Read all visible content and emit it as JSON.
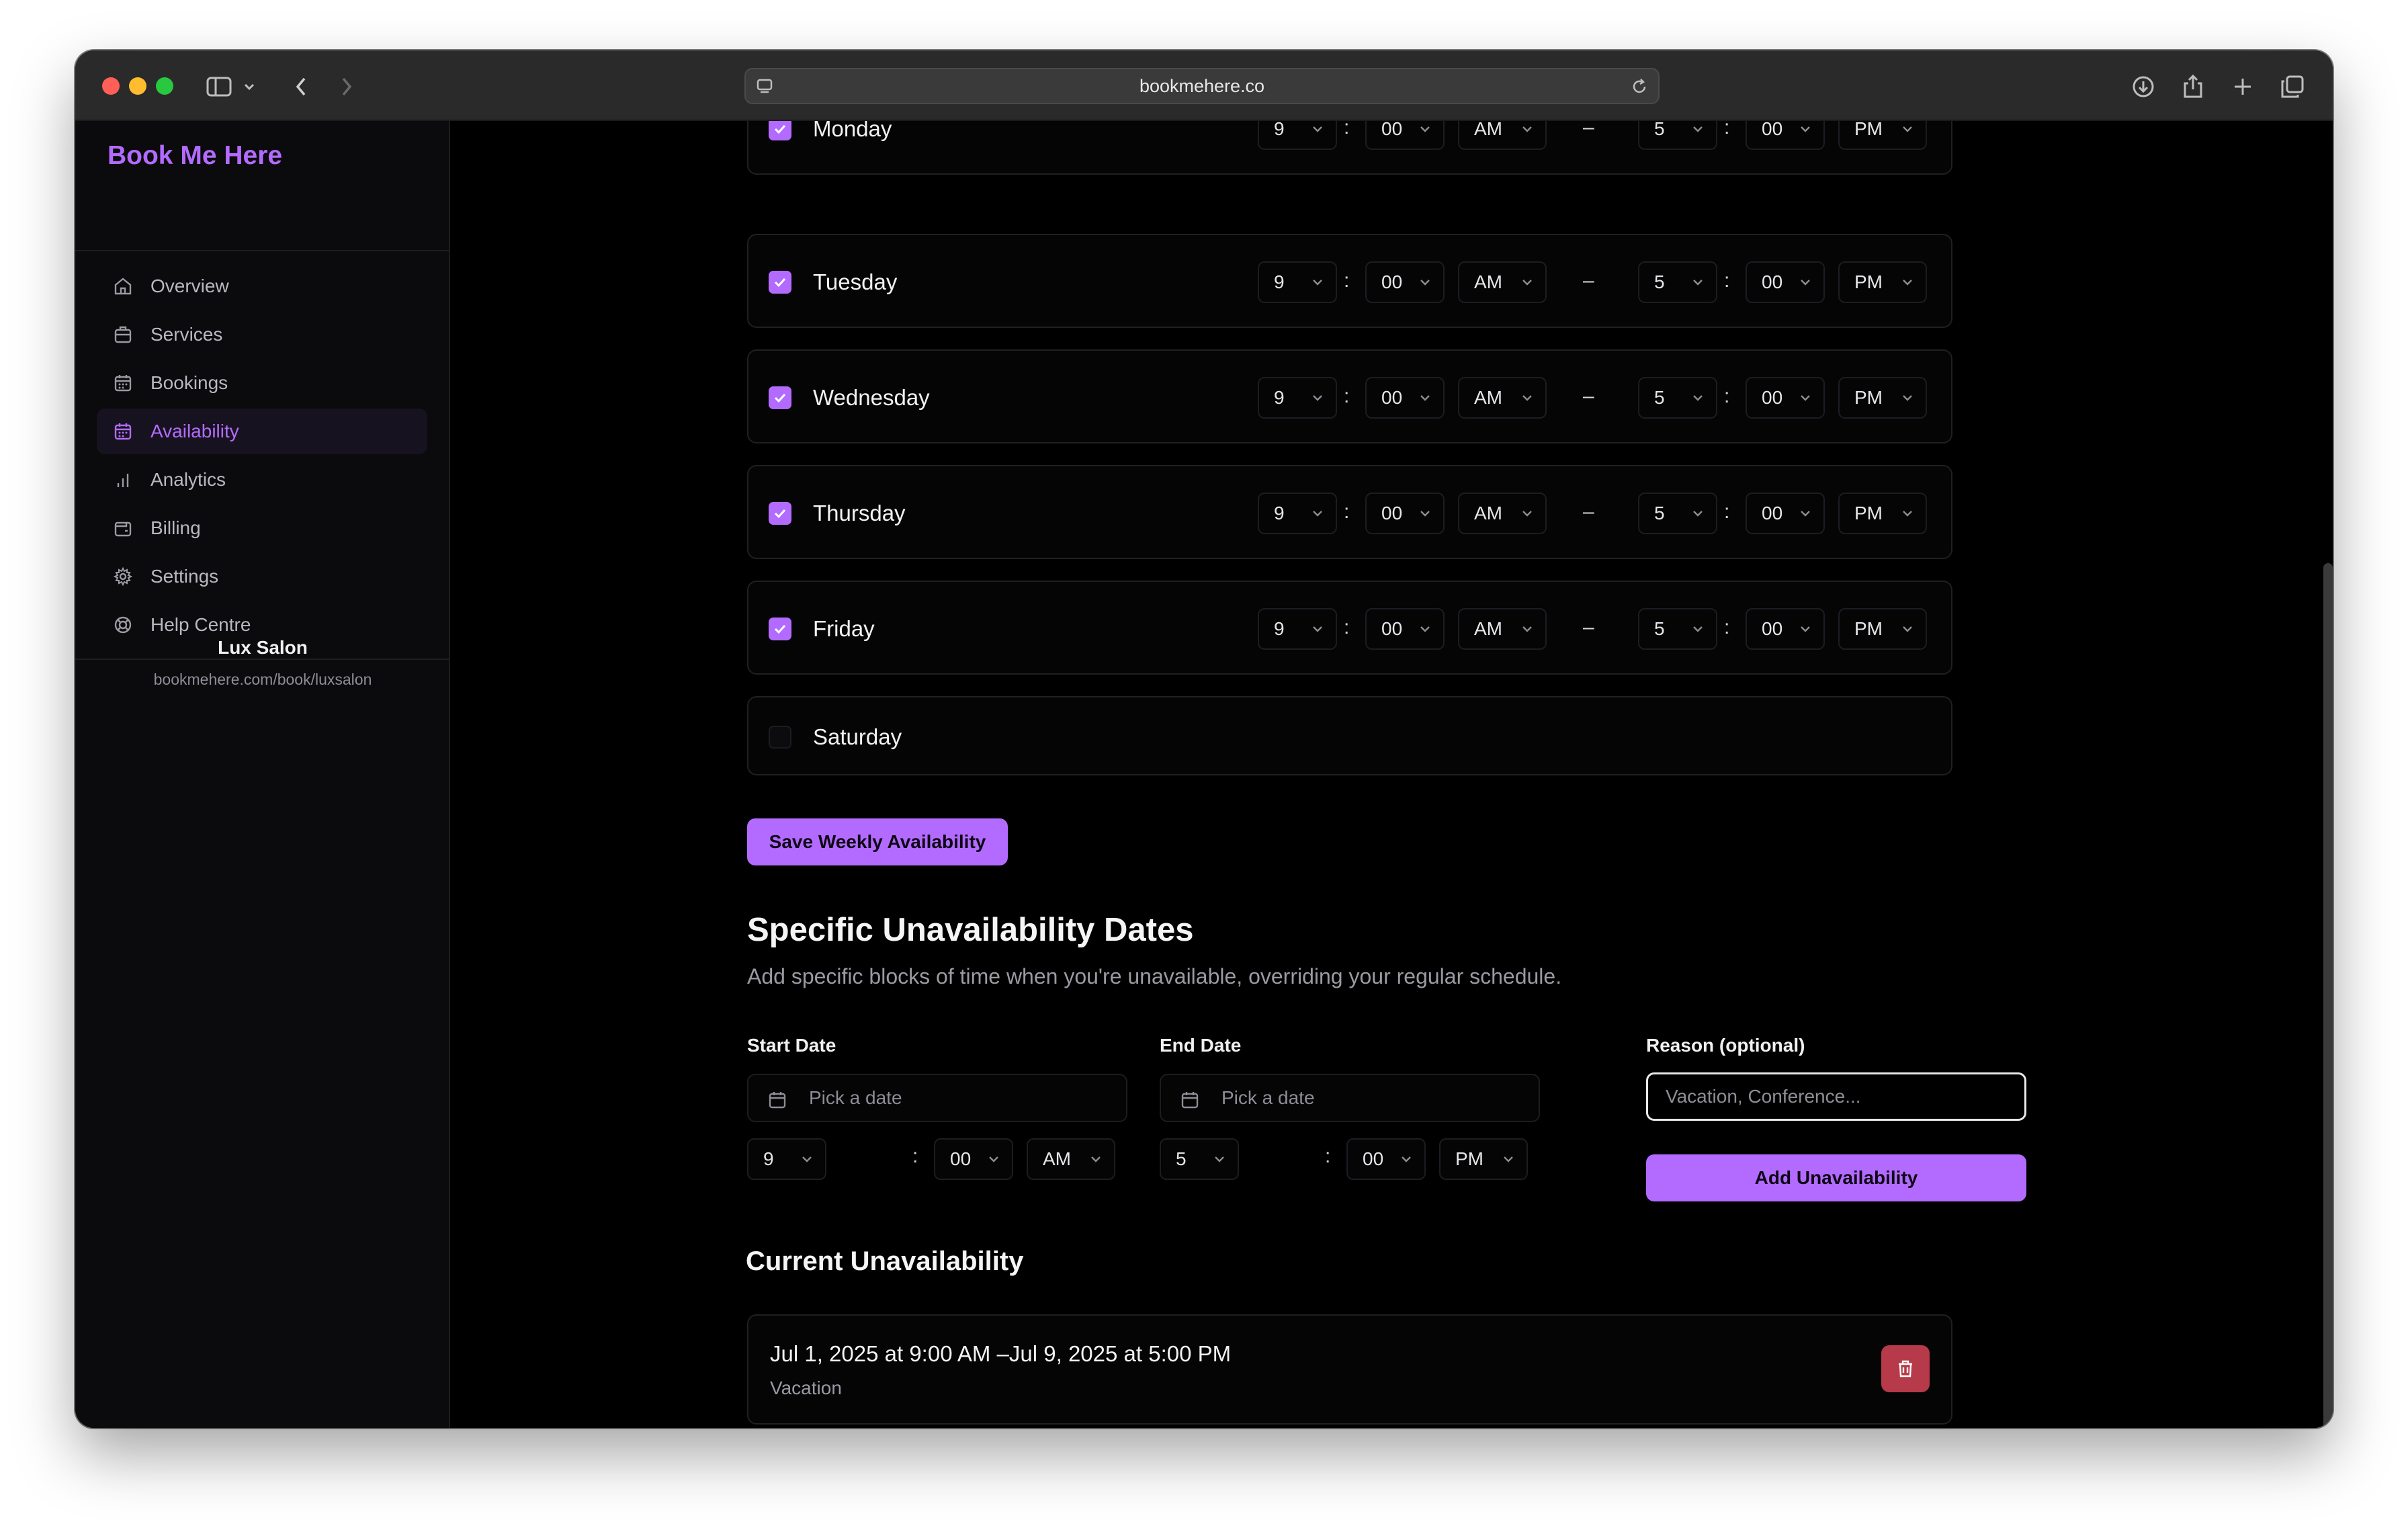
{
  "browser": {
    "url": "bookmehere.co"
  },
  "sidebar": {
    "brand": "Book Me Here",
    "items": [
      {
        "label": "Overview"
      },
      {
        "label": "Services"
      },
      {
        "label": "Bookings"
      },
      {
        "label": "Availability",
        "active": true
      },
      {
        "label": "Analytics"
      },
      {
        "label": "Billing"
      },
      {
        "label": "Settings"
      },
      {
        "label": "Help Centre"
      }
    ],
    "salon_name": "Lux Salon",
    "salon_url": "bookmehere.com/book/luxsalon"
  },
  "weekly": {
    "days": [
      {
        "name": "Monday",
        "enabled": true,
        "start_hour": "9",
        "start_min": "00",
        "start_ampm": "AM",
        "end_hour": "5",
        "end_min": "00",
        "end_ampm": "PM"
      },
      {
        "name": "Tuesday",
        "enabled": true,
        "start_hour": "9",
        "start_min": "00",
        "start_ampm": "AM",
        "end_hour": "5",
        "end_min": "00",
        "end_ampm": "PM"
      },
      {
        "name": "Wednesday",
        "enabled": true,
        "start_hour": "9",
        "start_min": "00",
        "start_ampm": "AM",
        "end_hour": "5",
        "end_min": "00",
        "end_ampm": "PM"
      },
      {
        "name": "Thursday",
        "enabled": true,
        "start_hour": "9",
        "start_min": "00",
        "start_ampm": "AM",
        "end_hour": "5",
        "end_min": "00",
        "end_ampm": "PM"
      },
      {
        "name": "Friday",
        "enabled": true,
        "start_hour": "9",
        "start_min": "00",
        "start_ampm": "AM",
        "end_hour": "5",
        "end_min": "00",
        "end_ampm": "PM"
      },
      {
        "name": "Saturday",
        "enabled": false
      }
    ],
    "separator": ":",
    "range_dash": "–",
    "save_label": "Save Weekly Availability"
  },
  "unavailability": {
    "title": "Specific Unavailability Dates",
    "description": "Add specific blocks of time when you're unavailable, overriding your regular schedule.",
    "start_label": "Start Date",
    "end_label": "End Date",
    "reason_label": "Reason (optional)",
    "date_placeholder": "Pick a date",
    "reason_placeholder": "Vacation, Conference...",
    "start_time": {
      "hour": "9",
      "min": "00",
      "ampm": "AM"
    },
    "end_time": {
      "hour": "5",
      "min": "00",
      "ampm": "PM"
    },
    "add_label": "Add Unavailability"
  },
  "current": {
    "title": "Current Unavailability",
    "entries": [
      {
        "range": "Jul 1, 2025 at 9:00 AM –Jul 9, 2025 at 5:00 PM",
        "reason": "Vacation"
      }
    ]
  },
  "colors": {
    "accent": "#b36bff",
    "danger": "#b73a4a"
  }
}
